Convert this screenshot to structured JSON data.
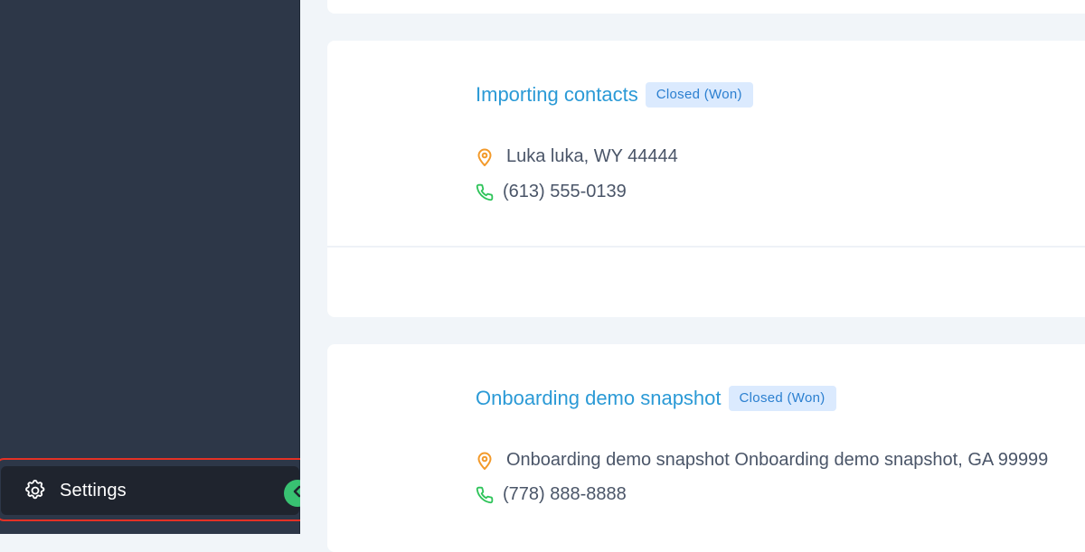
{
  "sidebar": {
    "settings_label": "Settings",
    "settings_icon": "gear-icon",
    "collapse_icon": "chevron-left-icon"
  },
  "opportunities": [
    {
      "title": "Importing contacts",
      "status": "Closed (Won)",
      "address": "Luka luka, WY 44444",
      "phone": "(613) 555-0139"
    },
    {
      "title": "Onboarding demo snapshot",
      "status": "Closed (Won)",
      "address": "Onboarding demo snapshot Onboarding demo snapshot, GA 99999",
      "phone": "(778) 888-8888"
    }
  ],
  "colors": {
    "sidebar_bg": "#2d3748",
    "accent_blue": "#2b9ad6",
    "badge_bg": "#dbeafe",
    "location_icon": "#f39a2a",
    "phone_icon": "#2fc45a",
    "collapse_button": "#38c172",
    "highlight": "#e43125"
  }
}
